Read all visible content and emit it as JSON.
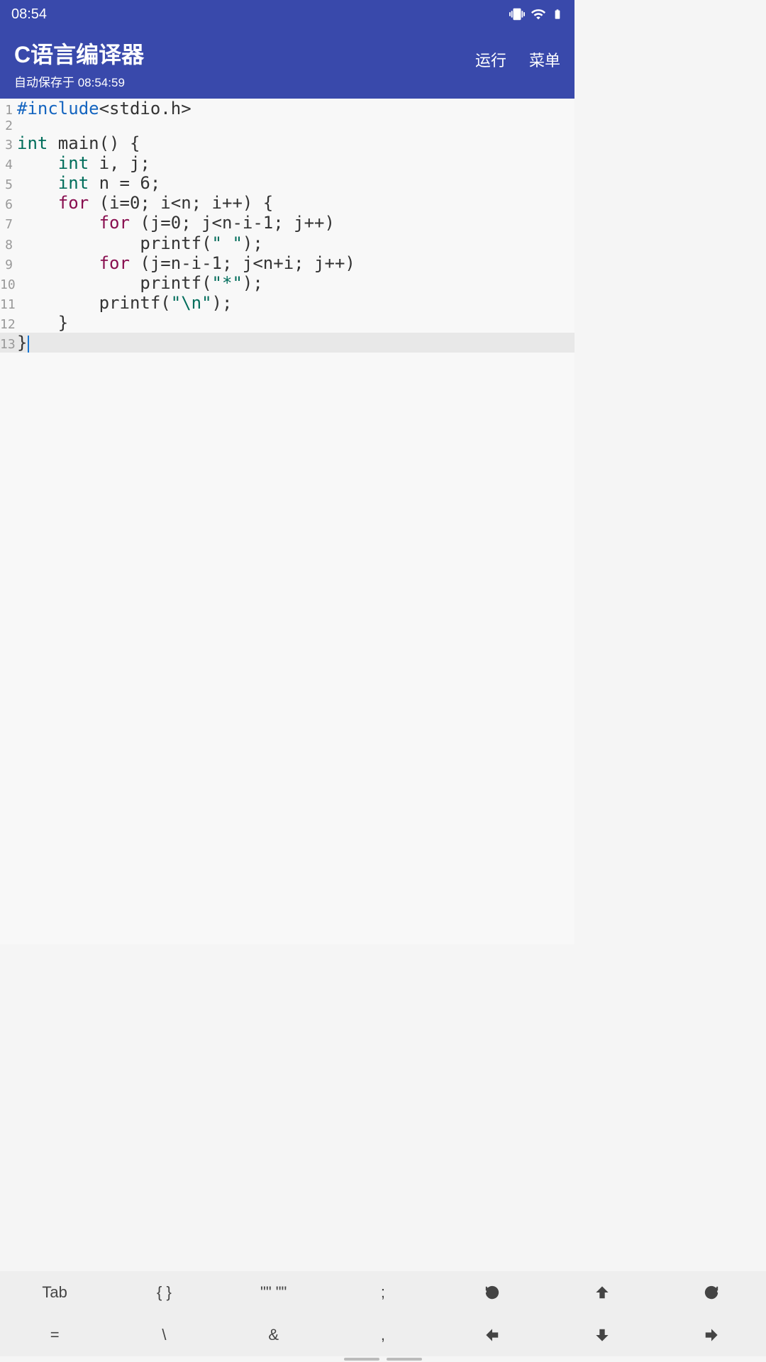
{
  "status_bar": {
    "time": "08:54"
  },
  "app_bar": {
    "title": "C语言编译器",
    "subtitle": "自动保存于 08:54:59",
    "run_label": "运行",
    "menu_label": "菜单"
  },
  "editor": {
    "current_line": 13,
    "lines": [
      {
        "n": "1",
        "tokens": [
          [
            "preproc",
            "#include"
          ],
          [
            "plain",
            "<stdio.h>"
          ]
        ]
      },
      {
        "n": "2",
        "tokens": []
      },
      {
        "n": "3",
        "tokens": [
          [
            "keyword",
            "int"
          ],
          [
            "plain",
            " main() {"
          ]
        ]
      },
      {
        "n": "4",
        "tokens": [
          [
            "plain",
            "    "
          ],
          [
            "keyword",
            "int"
          ],
          [
            "plain",
            " i, j;"
          ]
        ]
      },
      {
        "n": "5",
        "tokens": [
          [
            "plain",
            "    "
          ],
          [
            "keyword",
            "int"
          ],
          [
            "plain",
            " n = 6;"
          ]
        ]
      },
      {
        "n": "6",
        "tokens": [
          [
            "plain",
            "    "
          ],
          [
            "control",
            "for"
          ],
          [
            "plain",
            " (i=0; i<n; i++) {"
          ]
        ]
      },
      {
        "n": "7",
        "tokens": [
          [
            "plain",
            "        "
          ],
          [
            "control",
            "for"
          ],
          [
            "plain",
            " (j=0; j<n-i-1; j++)"
          ]
        ]
      },
      {
        "n": "8",
        "tokens": [
          [
            "plain",
            "            printf("
          ],
          [
            "string",
            "\" \""
          ],
          [
            "plain",
            ");"
          ]
        ]
      },
      {
        "n": "9",
        "tokens": [
          [
            "plain",
            "        "
          ],
          [
            "control",
            "for"
          ],
          [
            "plain",
            " (j=n-i-1; j<n+i; j++)"
          ]
        ]
      },
      {
        "n": "10",
        "tokens": [
          [
            "plain",
            "            printf("
          ],
          [
            "string",
            "\"*\""
          ],
          [
            "plain",
            ");"
          ]
        ]
      },
      {
        "n": "11",
        "tokens": [
          [
            "plain",
            "        printf("
          ],
          [
            "string",
            "\"\\n\""
          ],
          [
            "plain",
            ");"
          ]
        ]
      },
      {
        "n": "12",
        "tokens": [
          [
            "plain",
            "    }"
          ]
        ]
      },
      {
        "n": "13",
        "tokens": [
          [
            "plain",
            "}"
          ]
        ]
      }
    ]
  },
  "keyboard": {
    "row1": [
      "Tab",
      "{ }",
      "\"\" \"\"",
      ";",
      "undo-icon",
      "arrow-up-icon",
      "redo-icon"
    ],
    "row2": [
      "=",
      "\\",
      "&",
      ",",
      "arrow-left-icon",
      "arrow-down-icon",
      "arrow-right-icon"
    ]
  }
}
